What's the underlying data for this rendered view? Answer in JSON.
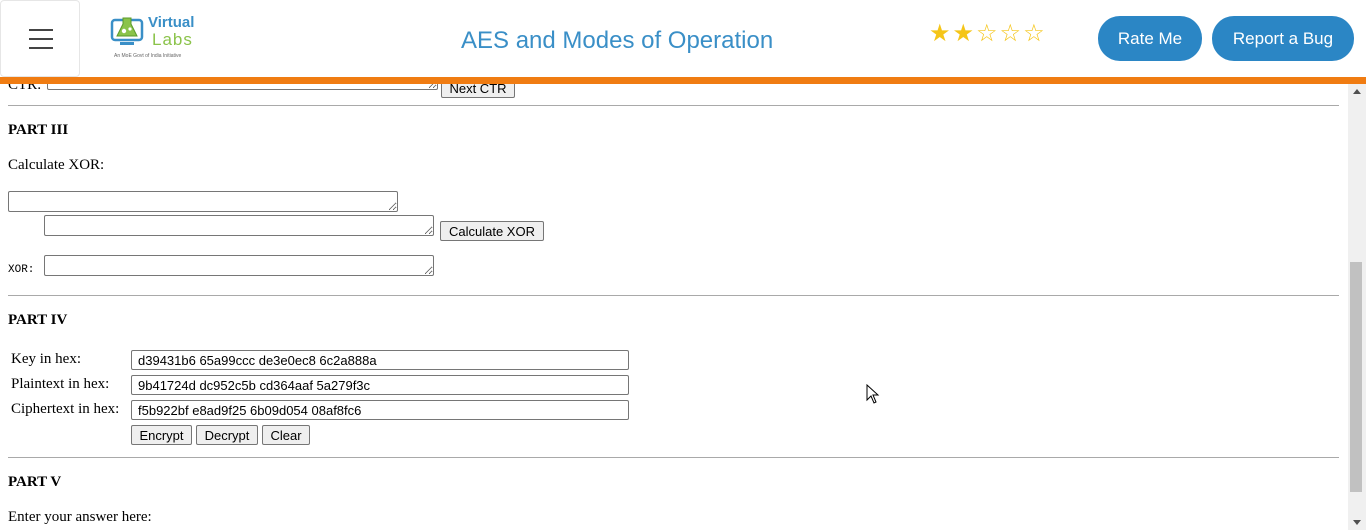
{
  "header": {
    "logo_text_top": "Virtual",
    "logo_text_bottom": "Labs",
    "logo_tagline": "An MoE Govt of India Initiative",
    "title": "AES and Modes of Operation",
    "rating": {
      "filled": 2,
      "total": 5,
      "filled_glyph": "★",
      "empty_glyph": "☆"
    },
    "rate_label": "Rate Me",
    "bug_label": "Report a Bug",
    "accent_color": "#f07c12",
    "brand_color": "#2b86c5"
  },
  "top_partial": {
    "ctr_label": "CTR:",
    "next_ctr_label": "Next CTR"
  },
  "part3": {
    "heading": "PART III",
    "prompt": "Calculate XOR:",
    "calc_label": "Calculate XOR",
    "xor_label": "XOR:"
  },
  "part4": {
    "heading": "PART IV",
    "key_label": "Key in hex:",
    "key_value": "d39431b6 65a99ccc de3e0ec8 6c2a888a",
    "plain_label": "Plaintext in hex:",
    "plain_value": "9b41724d dc952c5b cd364aaf 5a279f3c",
    "cipher_label": "Ciphertext in hex:",
    "cipher_value": "f5b922bf e8ad9f25 6b09d054 08af8fc6",
    "encrypt_label": "Encrypt",
    "decrypt_label": "Decrypt",
    "clear_label": "Clear"
  },
  "part5": {
    "heading": "PART V",
    "prompt": "Enter your answer here:"
  }
}
